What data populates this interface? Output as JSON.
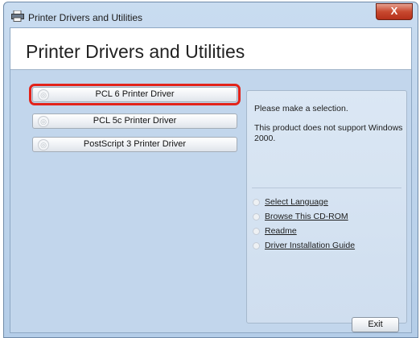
{
  "window": {
    "title": "Printer Drivers and Utilities",
    "close_glyph": "X"
  },
  "page": {
    "title": "Printer Drivers and Utilities"
  },
  "drivers": [
    {
      "label": "PCL 6 Printer Driver",
      "selected": true
    },
    {
      "label": "PCL 5c Printer Driver",
      "selected": false
    },
    {
      "label": "PostScript 3 Printer Driver",
      "selected": false
    }
  ],
  "panel": {
    "prompt": "Please make a selection.",
    "message": "This product does not support Windows 2000.",
    "links": [
      {
        "label": "Select Language"
      },
      {
        "label": "Browse This CD-ROM"
      },
      {
        "label": "Readme"
      },
      {
        "label": "Driver Installation Guide"
      }
    ]
  },
  "footer": {
    "exit_label": "Exit"
  },
  "colors": {
    "selection_highlight": "#e3231a",
    "client_bg": "#c2d6ec"
  },
  "icons": {
    "title": "printer-icon",
    "button": "disc-icon"
  }
}
